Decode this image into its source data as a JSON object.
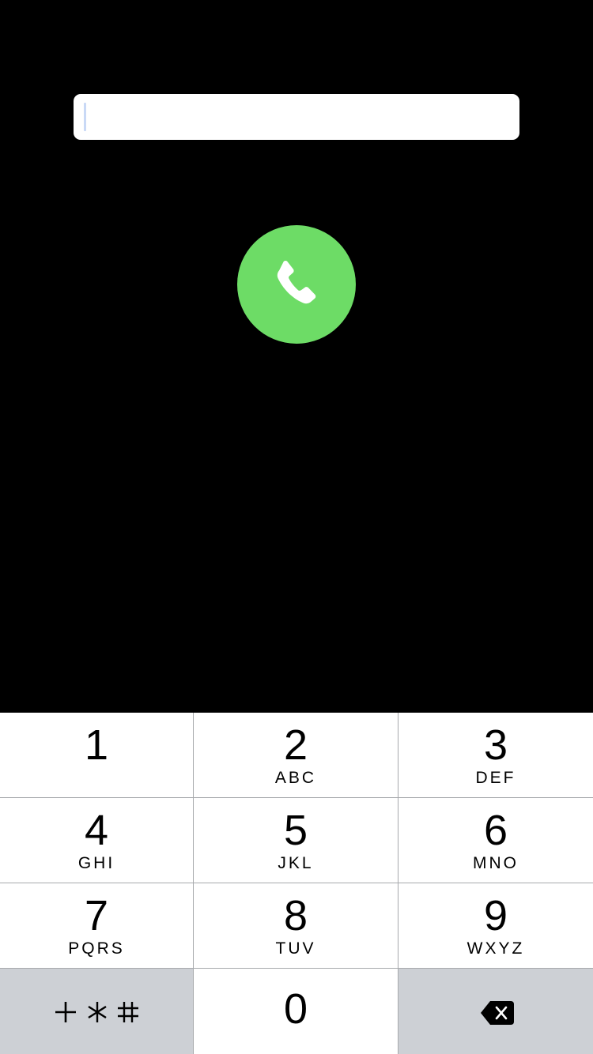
{
  "dialer": {
    "number_value": "",
    "call_button_label": "Call"
  },
  "colors": {
    "background": "#000000",
    "call_green": "#6ddc66",
    "key_background": "#ffffff",
    "function_key_background": "#cdd0d5",
    "separator": "#a7a9ac"
  },
  "keypad": {
    "keys": [
      {
        "digit": "1",
        "letters": ""
      },
      {
        "digit": "2",
        "letters": "ABC"
      },
      {
        "digit": "3",
        "letters": "DEF"
      },
      {
        "digit": "4",
        "letters": "GHI"
      },
      {
        "digit": "5",
        "letters": "JKL"
      },
      {
        "digit": "6",
        "letters": "MNO"
      },
      {
        "digit": "7",
        "letters": "PQRS"
      },
      {
        "digit": "8",
        "letters": "TUV"
      },
      {
        "digit": "9",
        "letters": "WXYZ"
      },
      {
        "digit": "0",
        "letters": ""
      }
    ],
    "symbols_key_icon": "plus-asterisk-hash-icon",
    "delete_key_icon": "backspace-icon"
  },
  "icons": {
    "call": "phone-handset-icon"
  }
}
